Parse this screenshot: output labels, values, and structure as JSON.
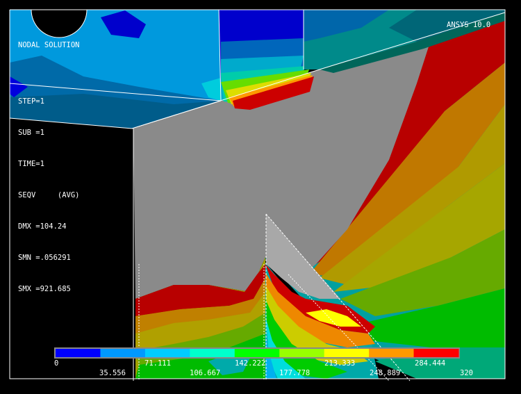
{
  "title_label": "NODAL SOLUTION",
  "version_label": "ANSYS 10.0",
  "info_lines": {
    "step": "STEP=1",
    "sub": "SUB =1",
    "time": "TIME=1",
    "seqv": "SEQV     (AVG)",
    "dmx": "DMX =104.24",
    "smn": "SMN =.056291",
    "smx": "SMX =921.685"
  },
  "legend": {
    "colors": [
      "#0000ff",
      "#0099ff",
      "#00ccff",
      "#00ffcc",
      "#00ff00",
      "#99ff00",
      "#ffff00",
      "#ff9900",
      "#ff0000"
    ],
    "labels_top": [
      "0",
      "71.111",
      "142.222",
      "213.333",
      "284.444"
    ],
    "labels_bottom": [
      "35.556",
      "106.667",
      "177.778",
      "248.889",
      "320"
    ]
  },
  "palette": {
    "background": "#000000",
    "frame": "#ffffff",
    "gray_region": "#8a8a8a",
    "light_gray_region": "#a8a8a8"
  }
}
